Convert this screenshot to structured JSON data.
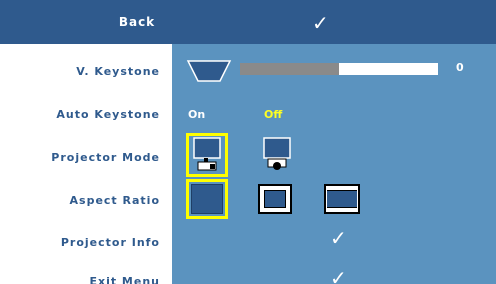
{
  "menu": {
    "back_label": "Back",
    "back_check": "✓",
    "items": [
      {
        "label": "V. Keystone"
      },
      {
        "label": "Auto Keystone"
      },
      {
        "label": "Projector Mode"
      },
      {
        "label": "Aspect Ratio"
      },
      {
        "label": "Projector Info"
      },
      {
        "label": "Exit Menu"
      }
    ]
  },
  "keystone": {
    "value": "0",
    "level_fraction": 0.5
  },
  "auto_keystone": {
    "on_label": "On",
    "off_label": "Off",
    "selected": "Off"
  },
  "projector_mode": {
    "options": [
      "front-projection-icon",
      "ceiling-projection-icon"
    ],
    "selected_index": 0
  },
  "aspect_ratio": {
    "options": [
      "aspect-original-icon",
      "aspect-4-3-icon",
      "aspect-wide-icon"
    ],
    "selected_index": 0
  },
  "projector_info": {
    "check": "✓"
  },
  "exit_menu": {
    "check": "✓"
  },
  "colors": {
    "header": "#2f5a8d",
    "panel": "#5b93bf",
    "label_text": "#2f5a8d",
    "highlight": "#ffff00"
  }
}
